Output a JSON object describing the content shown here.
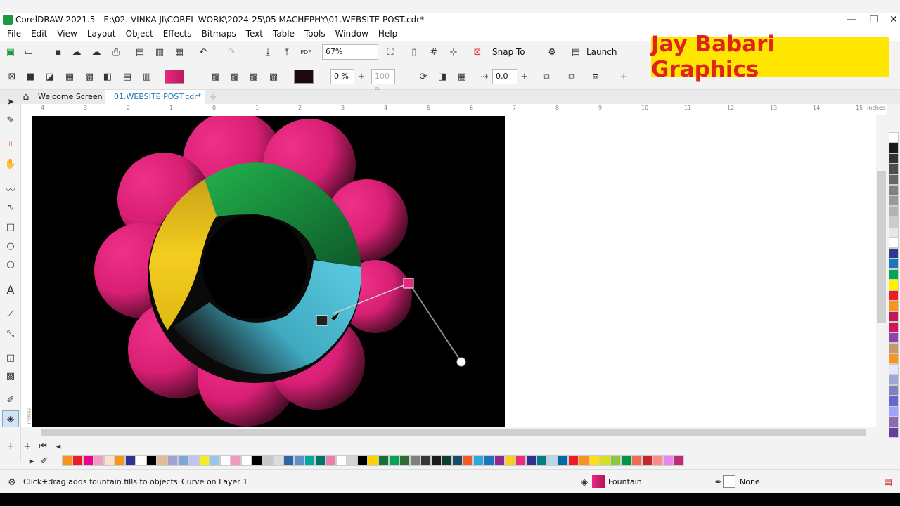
{
  "title": "CorelDRAW 2021.5 - E:\\02. VINKA JI\\COREL WORK\\2024-25\\05 MACHEPHY\\01.WEBSITE POST.cdr*",
  "window_controls": {
    "minimize": "—",
    "maximize": "❐",
    "close": "✕"
  },
  "menu": [
    "File",
    "Edit",
    "View",
    "Layout",
    "Object",
    "Effects",
    "Bitmaps",
    "Text",
    "Table",
    "Tools",
    "Window",
    "Help"
  ],
  "toolbar": {
    "zoom": "67%",
    "snap_label": "Snap To",
    "launch_label": "Launch",
    "pdf": "PDF"
  },
  "property_bar": {
    "transparency": "0 %",
    "opacity": "100 %",
    "offset": "0.0"
  },
  "brand": "Jay Babari Graphics",
  "tabs": [
    "Welcome Screen",
    "01.WEBSITE POST.cdr*"
  ],
  "ruler": {
    "top": [
      "4",
      "3",
      "2",
      "1",
      "0",
      "1",
      "2",
      "3",
      "4",
      "5",
      "6",
      "7",
      "8",
      "9",
      "10",
      "11",
      "12",
      "13",
      "14",
      "15"
    ],
    "unit": "inches",
    "side_unit": "inches"
  },
  "status": {
    "hint": "Click+drag adds fountain fills to objects",
    "object": "Curve on Layer 1",
    "fill_label": "Fountain",
    "outline_label": "None"
  },
  "colors": {
    "pink": "#e8287f",
    "green": "#1a9a43",
    "yellow": "#e9c21f",
    "cyan": "#52c3d6",
    "palette_right": [
      "#ffffff",
      "#1a1a1a",
      "#333333",
      "#4d4d4d",
      "#666666",
      "#808080",
      "#999999",
      "#b3b3b3",
      "#cccccc",
      "#e6e6e6",
      "#ffffff",
      "#2b3990",
      "#1c75bc",
      "#00a651",
      "#fff200",
      "#ed1c24",
      "#f7941d",
      "#c2185b",
      "#d4145a",
      "#8e44ad",
      "#c49a6c",
      "#f7941d",
      "#e6e6fa",
      "#9ea7d8",
      "#8080c0",
      "#6666cc",
      "#a0a0ff",
      "#8c6bb1",
      "#6a3d9a"
    ],
    "palette_bottom": [
      "#f7941d",
      "#ed1c24",
      "#ec008c",
      "#f49ac1",
      "#fbe3c9",
      "#f7941d",
      "#2e3192",
      "#ffffff",
      "#000000",
      "#e6b89c",
      "#a3a3d1",
      "#7da7d9",
      "#c2c2f0",
      "#f7ec26",
      "#9bc6e8",
      "#ffffff",
      "#f49ac1",
      "#ffffff",
      "#000000",
      "#c7c7c7",
      "#dddddd",
      "#2f64a6",
      "#5e8fc9",
      "#00a99d",
      "#00746b",
      "#ed7dab",
      "#ffffff",
      "#d3d3d3",
      "#000000",
      "#ffd200",
      "#1a6e3a",
      "#00a651",
      "#2b6e31",
      "#808080",
      "#363636",
      "#1a1a1a",
      "#0f3d2e",
      "#1a4a6b",
      "#f15a24",
      "#29abe2",
      "#1b75bc",
      "#92278f",
      "#f7d117",
      "#ee2a7b",
      "#2e3192",
      "#008080",
      "#b9d7ea",
      "#0068a7",
      "#ed1c24",
      "#f7941d",
      "#ffde17",
      "#d7df23",
      "#8dc63f",
      "#009444",
      "#f26a4f",
      "#c1272d",
      "#ff8a8a",
      "#ee82ee",
      "#bd2c7a"
    ]
  }
}
